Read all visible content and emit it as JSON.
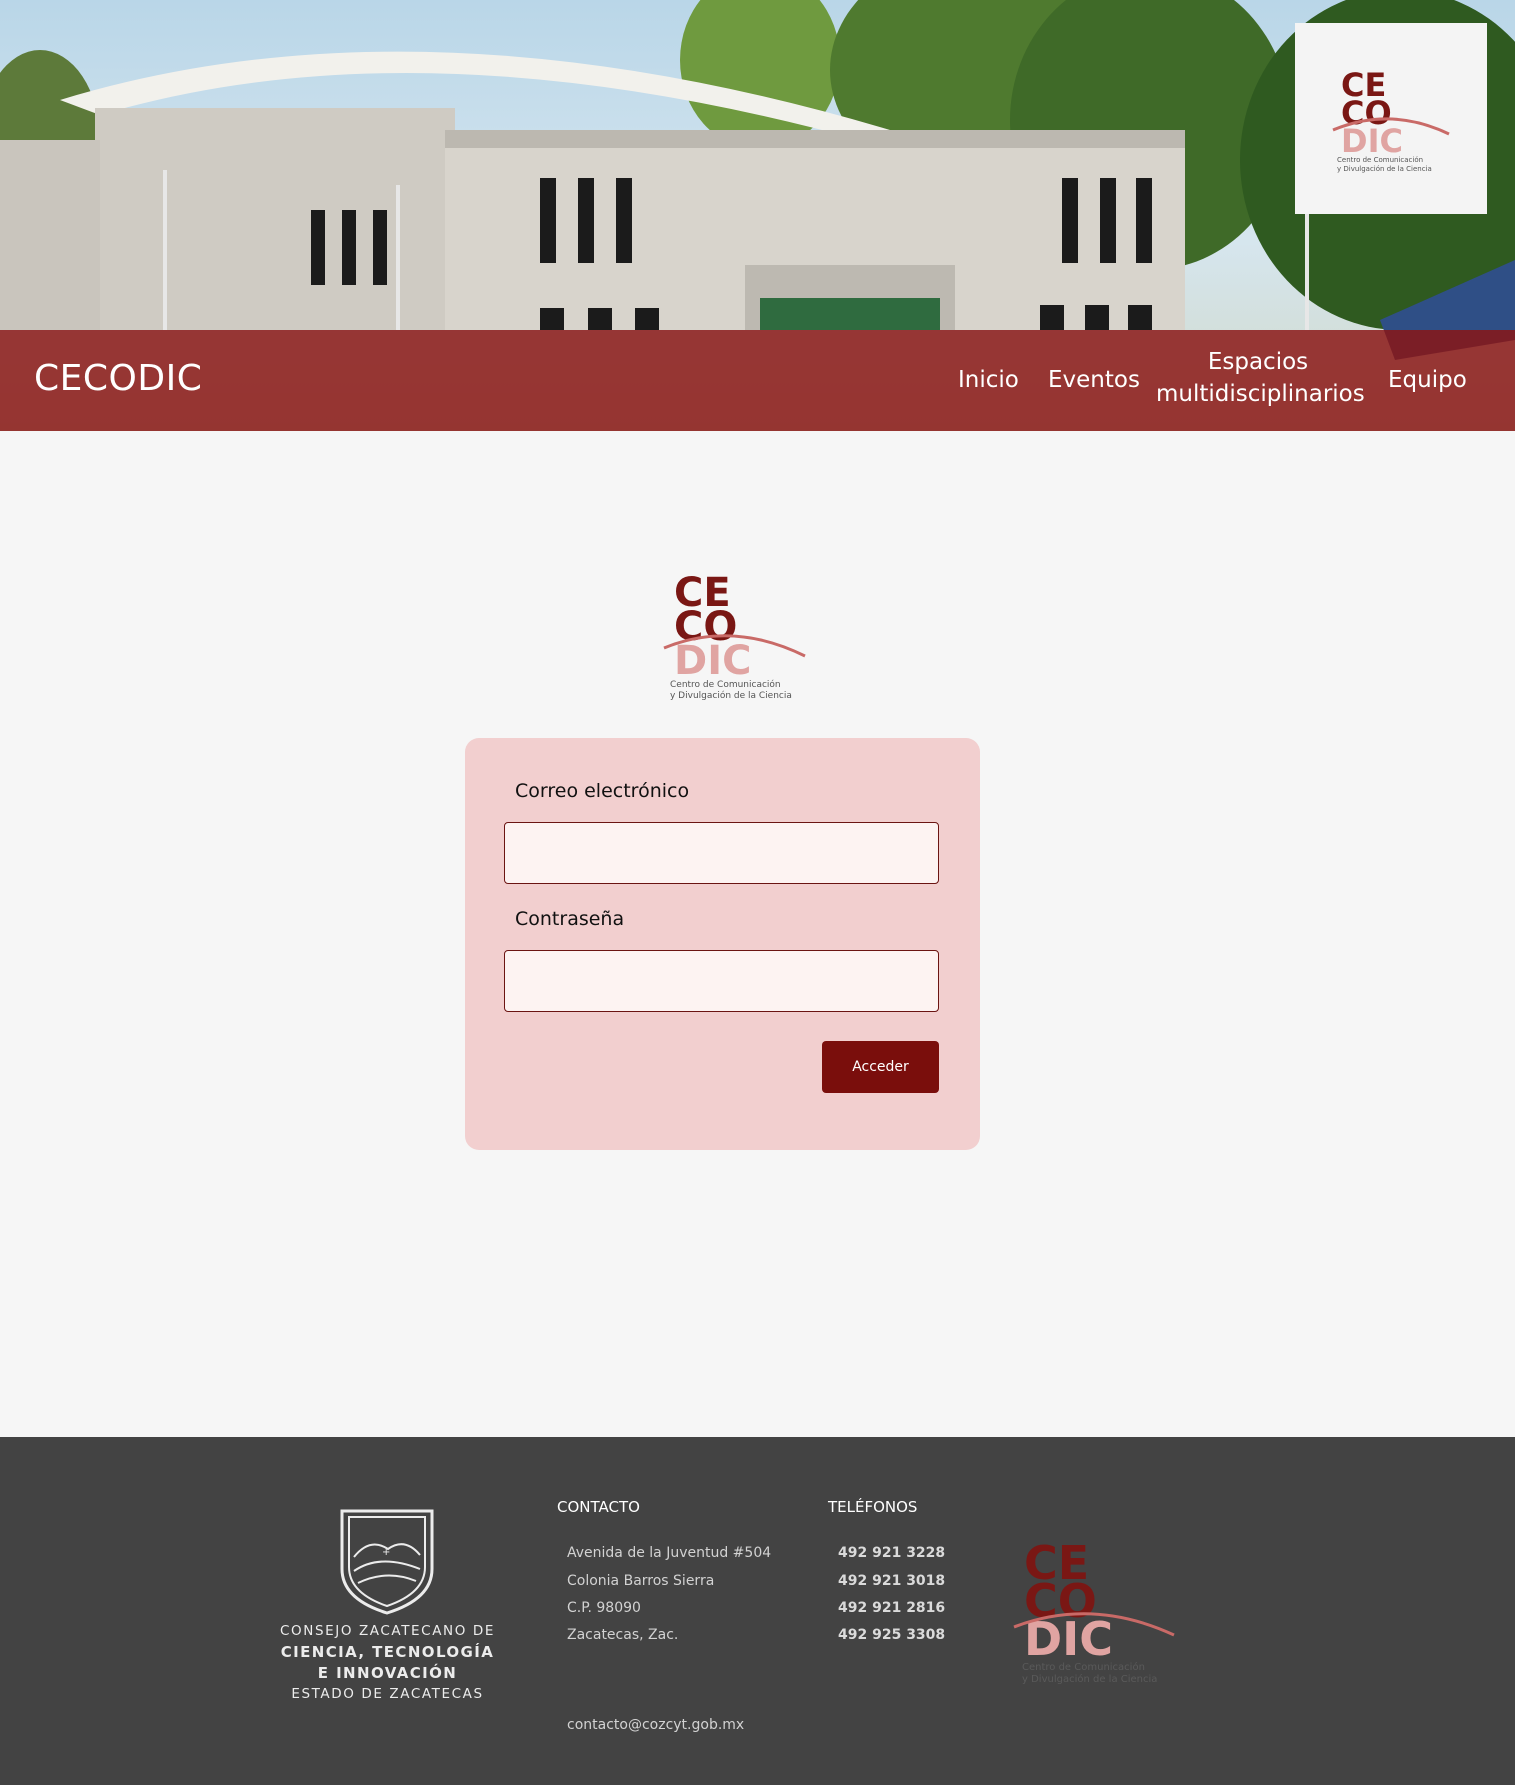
{
  "header": {
    "brand": "CECODIC",
    "nav": [
      {
        "label": "Inicio"
      },
      {
        "label": "Eventos"
      },
      {
        "label": "Espacios multidisciplinarios"
      },
      {
        "label": "Equipo"
      }
    ],
    "logo": {
      "line1": "CE",
      "line2": "CO",
      "line3": "DIC",
      "subtitle1": "Centro de Comunicación",
      "subtitle2": "y Divulgación de la Ciencia"
    }
  },
  "login": {
    "email_label": "Correo electrónico",
    "email_value": "",
    "password_label": "Contraseña",
    "password_value": "",
    "submit_label": "Acceder"
  },
  "footer": {
    "org": {
      "line1": "CONSEJO ZACATECANO DE",
      "line2": "CIENCIA, TECNOLOGÍA",
      "line3": "E INNOVACIÓN",
      "line4": "ESTADO DE ZACATECAS"
    },
    "contact": {
      "heading": "CONTACTO",
      "lines": [
        "Avenida de la Juventud #504",
        "Colonia Barros Sierra",
        "C.P. 98090",
        "Zacatecas, Zac."
      ],
      "email": "contacto@cozcyt.gob.mx"
    },
    "phones": {
      "heading": "TELÉFONOS",
      "numbers": [
        "492 921 3228",
        "492 921 3018",
        "492 921 2816",
        "492 925 3308"
      ]
    }
  },
  "colors": {
    "navbar": "#8a1614",
    "button": "#7a0e0c",
    "card": "#f2cfcf",
    "footer": "#434343",
    "logo_dark": "#7a1714",
    "logo_light": "#e0a4a2"
  }
}
